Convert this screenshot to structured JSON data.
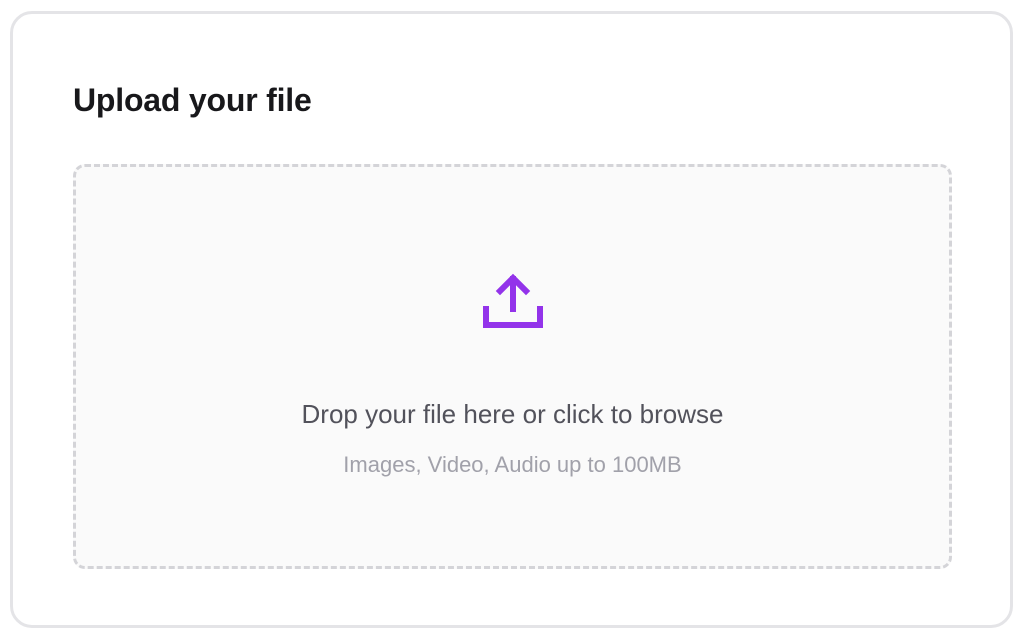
{
  "upload": {
    "title": "Upload your file",
    "icon": "upload-icon",
    "accent_color": "#9333ea",
    "dropzone": {
      "primary_text": "Drop your file here or click to browse",
      "secondary_text": "Images, Video, Audio up to 100MB"
    }
  }
}
